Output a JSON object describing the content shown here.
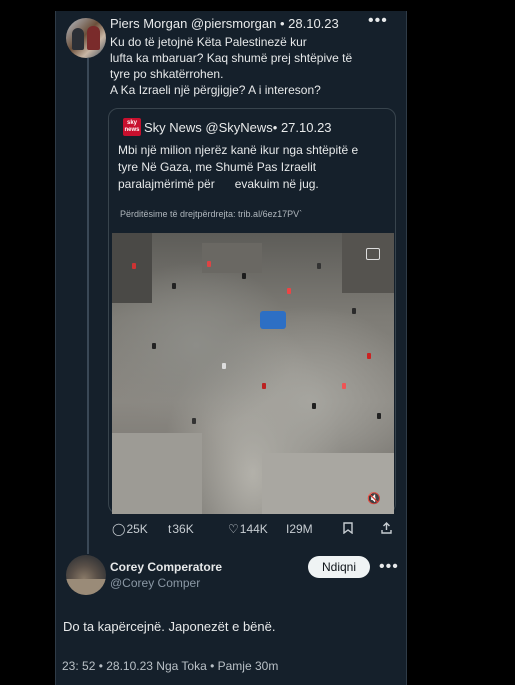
{
  "tweet": {
    "name_line": "Piers Morgan @piersmorgan • 28.10.23",
    "text_lines": [
      "Ku do të jetojnë Këta Palestinezë kur",
      "lufta ka mbaruar? Kaq shumë prej shtëpive të",
      "tyre po shkatërrohen.",
      "A Ka Izraeli një përgjigje? A i intereson?"
    ]
  },
  "quote": {
    "logo_text": "sky news",
    "name_line": "Sky News @SkyNews• 27.10.23",
    "text_lines": [
      "Mbi një milion njerëz kanë ikur nga shtëpitë e",
      "tyre Në Gaza, me Shumë Pas Izraelit",
      "paralajmërimë për      evakuim në jug."
    ],
    "link": "Përditësime të drejtpërdrejta: trib.al/6ez17PV`"
  },
  "actions": {
    "replies": "25K",
    "reposts": "36K",
    "likes": "144K",
    "views": "I29M"
  },
  "icons": {
    "reply": "reply-icon",
    "repost": "repost-icon",
    "like": "like-icon",
    "views": "views-icon",
    "bookmark": "bookmark-icon",
    "share": "share-icon",
    "more": "more-icon"
  },
  "reply": {
    "name": "Corey Comperatore",
    "handle": "@Corey Comper",
    "follow_label": "Ndiqni",
    "text": "Do ta kapërcejnë. Japonezët e bënë.",
    "meta": "23: 52 • 28.10.23 Nga Toka • Pamje 30m"
  },
  "colors": {
    "background": "#15202b",
    "outer": "#000000",
    "text": "#e7e9ea",
    "muted": "#8b98a5",
    "sky_red": "#c8102e"
  }
}
